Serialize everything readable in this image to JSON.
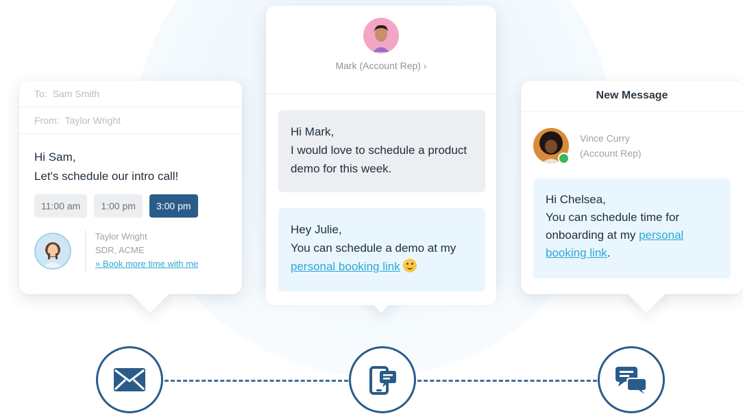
{
  "email_card": {
    "to_label": "To:",
    "to_value": "Sam Smith",
    "from_label": "From:",
    "from_value": "Taylor Wright",
    "greeting": "Hi Sam,",
    "message": "Let's schedule our intro call!",
    "time_slots": [
      "11:00 am",
      "1:00 pm",
      "3:00 pm"
    ],
    "selected_slot": "3:00 pm",
    "signature": {
      "name": "Taylor Wright",
      "title": "SDR, ACME",
      "link": "» Book more time with me"
    }
  },
  "chat_card": {
    "contact_name": "Mark (Account Rep)",
    "chevron": "›",
    "incoming": {
      "greeting": "Hi Mark,",
      "text": "I would love to schedule a product demo for this week."
    },
    "outgoing": {
      "greeting": "Hey Julie,",
      "text_before_link": "You can schedule a demo at my",
      "link": "personal booking link"
    }
  },
  "new_message_card": {
    "title": "New Message",
    "contact_name": "Vince Curry",
    "contact_role": "(Account Rep)",
    "greeting": "Hi Chelsea,",
    "text_before_link": "You can schedule time for onboarding at my",
    "link": "personal booking link",
    "text_after_link": "."
  },
  "channels": [
    {
      "name": "email",
      "icon": "envelope-icon"
    },
    {
      "name": "mobile",
      "icon": "phone-chat-icon"
    },
    {
      "name": "chat",
      "icon": "chat-bubbles-icon"
    }
  ],
  "colors": {
    "primary": "#2a5c8a",
    "link": "#2aa7d8",
    "bubble_blue": "#eaf6fd",
    "bubble_grey": "#eceef1",
    "online": "#3cb55e"
  }
}
